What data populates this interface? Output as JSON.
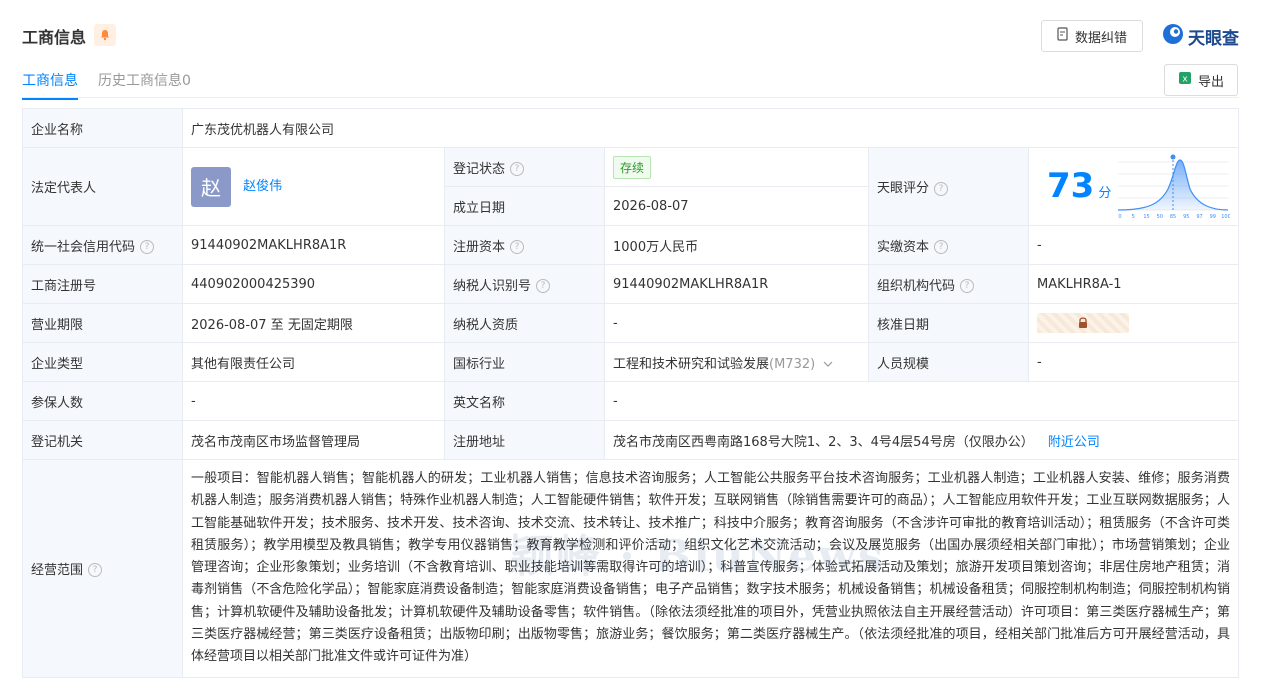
{
  "header": {
    "title": "工商信息",
    "correct_label": "数据纠错",
    "logo_text": "天眼查"
  },
  "tabs": [
    {
      "label": "工商信息",
      "active": true
    },
    {
      "label": "历史工商信息0",
      "active": false
    }
  ],
  "export_label": "导出",
  "company": {
    "name_label": "企业名称",
    "name": "广东茂优机器人有限公司",
    "legal_rep_label": "法定代表人",
    "legal_rep_avatar": "赵",
    "legal_rep": "赵俊伟",
    "status_label": "登记状态",
    "status": "存续",
    "founded_label": "成立日期",
    "founded": "2026-08-07",
    "tianyan_label": "天眼评分",
    "score": "73",
    "score_unit": "分",
    "score_ticks": [
      "0",
      "5",
      "15",
      "50",
      "85",
      "95",
      "97",
      "99",
      "100"
    ],
    "score_marker_percentile": 85,
    "credit_code_label": "统一社会信用代码",
    "credit_code": "91440902MAKLHR8A1R",
    "reg_capital_label": "注册资本",
    "reg_capital": "1000万人民币",
    "paid_capital_label": "实缴资本",
    "paid_capital": "-",
    "reg_no_label": "工商注册号",
    "reg_no": "440902000425390",
    "taxpayer_id_label": "纳税人识别号",
    "taxpayer_id": "91440902MAKLHR8A1R",
    "org_code_label": "组织机构代码",
    "org_code": "MAKLHR8A-1",
    "term_label": "营业期限",
    "term": "2026-08-07 至 无固定期限",
    "taxpayer_qual_label": "纳税人资质",
    "taxpayer_qual": "-",
    "approval_date_label": "核准日期",
    "type_label": "企业类型",
    "type": "其他有限责任公司",
    "industry_label": "国标行业",
    "industry": "工程和技术研究和试验发展",
    "industry_code": "(M732)",
    "staff_size_label": "人员规模",
    "staff_size": "-",
    "insured_label": "参保人数",
    "insured": "-",
    "english_name_label": "英文名称",
    "english_name": "-",
    "authority_label": "登记机关",
    "authority": "茂名市茂南区市场监督管理局",
    "address_label": "注册地址",
    "address": "茂名市茂南区西粤南路168号大院1、2、3、4号4层54号房（仅限办公）",
    "nearby_label": "附近公司",
    "scope_label": "经营范围",
    "scope": "一般项目：智能机器人销售；智能机器人的研发；工业机器人销售；信息技术咨询服务；人工智能公共服务平台技术咨询服务；工业机器人制造；工业机器人安装、维修；服务消费机器人制造；服务消费机器人销售；特殊作业机器人制造；人工智能硬件销售；软件开发；互联网销售（除销售需要许可的商品）；人工智能应用软件开发；工业互联网数据服务；人工智能基础软件开发；技术服务、技术开发、技术咨询、技术交流、技术转让、技术推广；科技中介服务；教育咨询服务（不含涉许可审批的教育培训活动）；租赁服务（不含许可类租赁服务）；教学用模型及教具销售；教学专用仪器销售；教育教学检测和评价活动；组织文化艺术交流活动；会议及展览服务（出国办展须经相关部门审批）；市场营销策划；企业管理咨询；企业形象策划；业务培训（不含教育培训、职业技能培训等需取得许可的培训）；科普宣传服务；体验式拓展活动及策划；旅游开发项目策划咨询；非居住房地产租赁；消毒剂销售（不含危险化学品）；智能家庭消费设备制造；智能家庭消费设备销售；电子产品销售；数字技术服务；机械设备销售；机械设备租赁；伺服控制机构制造；伺服控制机构销售；计算机软硬件及辅助设备批发；计算机软硬件及辅助设备零售；软件销售。（除依法须经批准的项目外，凭营业执照依法自主开展经营活动）许可项目：第三类医疗器械生产；第三类医疗器械经营；第三类医疗设备租赁；出版物印刷；出版物零售；旅游业务；餐饮服务；第二类医疗器械生产。（依法须经批准的项目，经相关部门批准后方可开展经营活动，具体经营项目以相关部门批准文件或许可证件为准）"
  },
  "watermark": "颖峰 · BiuNews",
  "colors": {
    "accent": "#0084ff",
    "status_green": "#2c9a27",
    "label_bg": "#f5f8fc",
    "border": "#e8ecf2"
  }
}
